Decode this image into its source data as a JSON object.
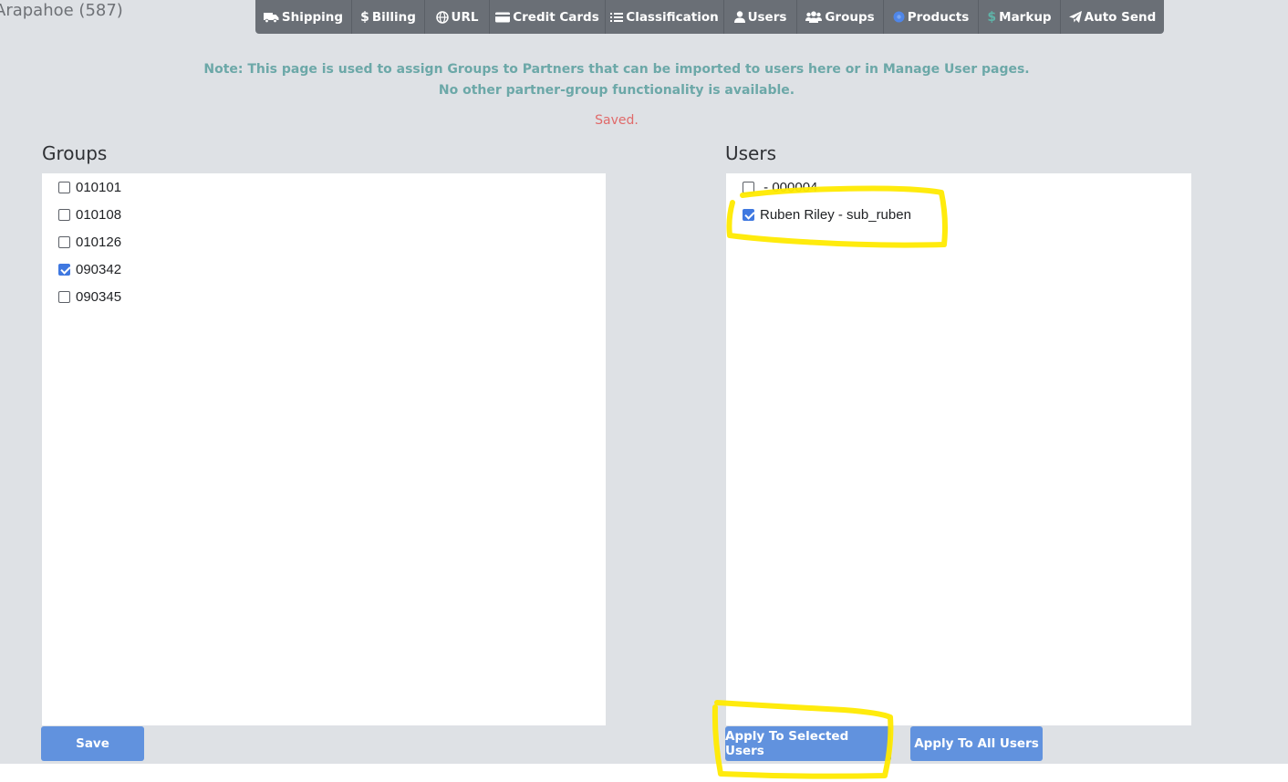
{
  "header": {
    "partner_title": "Arapahoe (587)"
  },
  "nav": {
    "items": [
      {
        "label": "Shipping",
        "icon": "truck-icon"
      },
      {
        "label": "Billing",
        "icon": "dollar-icon"
      },
      {
        "label": "URL",
        "icon": "globe-icon"
      },
      {
        "label": "Credit Cards",
        "icon": "credit-card-icon"
      },
      {
        "label": "Classification",
        "icon": "list-icon"
      },
      {
        "label": "Users",
        "icon": "user-icon"
      },
      {
        "label": "Groups",
        "icon": "users-icon"
      },
      {
        "label": "Products",
        "icon": "product-icon"
      },
      {
        "label": "Markup",
        "icon": "dollar-icon"
      },
      {
        "label": "Auto Send",
        "icon": "paper-plane-icon"
      }
    ]
  },
  "note": {
    "line1": "Note: This page is used to assign Groups to Partners that can be imported to users here or in Manage User pages.",
    "line2": "No other partner-group functionality is available."
  },
  "status": {
    "message": "Saved."
  },
  "groups": {
    "title": "Groups",
    "items": [
      {
        "label": "010101",
        "checked": false
      },
      {
        "label": "010108",
        "checked": false
      },
      {
        "label": "010126",
        "checked": false
      },
      {
        "label": "090342",
        "checked": true
      },
      {
        "label": "090345",
        "checked": false
      }
    ]
  },
  "users": {
    "title": "Users",
    "items": [
      {
        "label": " - 000004",
        "checked": false
      },
      {
        "label": "Ruben Riley - sub_ruben",
        "checked": true
      }
    ]
  },
  "buttons": {
    "save": "Save",
    "apply_selected": "Apply To Selected Users",
    "apply_all": "Apply To All Users"
  },
  "colors": {
    "page_bg": "#dee1e5",
    "navbar_bg": "#6a6f76",
    "note_text": "#6ca8a8",
    "status_text": "#e06a6a",
    "button_bg": "#6192de",
    "checkbox_checked": "#3f78e0",
    "highlight": "#ffea00"
  }
}
